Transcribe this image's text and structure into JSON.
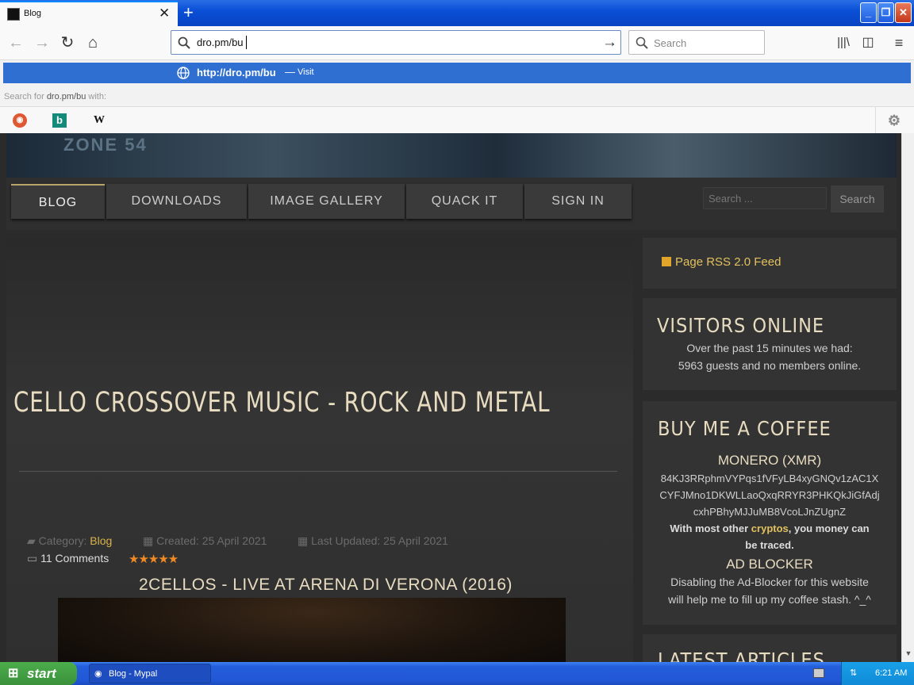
{
  "browser": {
    "tab_title": "Blog",
    "url_value": "dro.pm/bu",
    "search_placeholder": "Search",
    "suggestion_url": "http://dro.pm/bu",
    "suggestion_sep": "—",
    "suggestion_action": "Visit",
    "search_for_prefix": "Search for",
    "search_for_term": "dro.pm/bu",
    "search_for_suffix": "with:",
    "engines": [
      "duckduckgo",
      "bing",
      "wikipedia"
    ]
  },
  "site": {
    "menu": [
      "BLOG",
      "DOWNLOADS",
      "IMAGE GALLERY",
      "QUACK IT",
      "SIGN IN"
    ],
    "search_placeholder": "Search ...",
    "search_button": "Search",
    "banner_text": "ZONE 54"
  },
  "article": {
    "title": "CELLO CROSSOVER MUSIC - ROCK AND METAL",
    "category_label": "Category:",
    "category_value": "Blog",
    "created": "Created: 25 April 2021",
    "updated": "Last Updated: 25 April 2021",
    "comments": "11 Comments",
    "stars": "★★★★★",
    "rating": 5,
    "subtitle": "2CELLOS - LIVE AT ARENA DI VERONA (2016)"
  },
  "sidebar": {
    "rss": "Page RSS 2.0 Feed",
    "visitors_title": "VISITORS ONLINE",
    "visitors_line1": "Over the past 15 minutes we had:",
    "visitors_line2": "5963 guests and no members online.",
    "coffee_title": "BUY ME A COFFEE",
    "monero_title": "MONERO (XMR)",
    "monero_addr1": "84KJ3RRphmVYPqs1fVFyLB4xyGNQv1zAC1X",
    "monero_addr2": "CYFJMno1DKWLLaoQxqRRYR3PHKQkJiGfAdj",
    "monero_addr3": "cxhPBhyMJJuMB8VcoLJnZUgnZ",
    "crypto_pre": "With most other",
    "crypto_word": "cryptos",
    "crypto_post": ", you money can",
    "crypto_line2": "be traced.",
    "adblock_title": "AD BLOCKER",
    "adblock_line1": "Disabling the Ad-Blocker for this website",
    "adblock_line2": "will help me to fill up my coffee stash. ^_^",
    "latest_title": "LATEST ARTICLES"
  },
  "taskbar": {
    "start": "start",
    "task": "Blog - Mypal",
    "clock": "6:21 AM"
  },
  "colors": {
    "accent_gold": "#e8dcc0",
    "link_gold": "#d9b34a",
    "star_orange": "#f08a24",
    "suggest_blue": "#2f6fd2"
  }
}
